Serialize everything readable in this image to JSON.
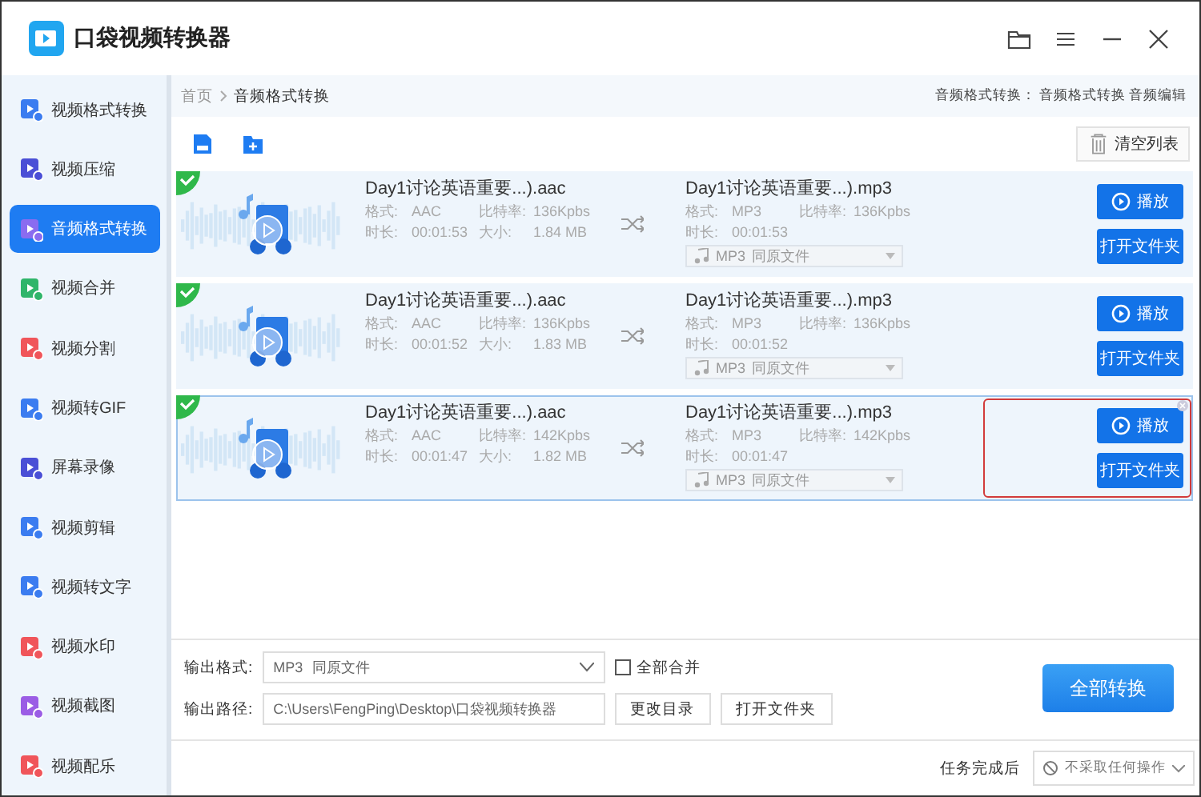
{
  "app": {
    "title": "口袋视频转换器"
  },
  "sidebar": {
    "items": [
      {
        "label": "视频格式转换",
        "selected": false,
        "color": "#3b7cf0"
      },
      {
        "label": "视频压缩",
        "selected": false,
        "color": "#4a4fd6"
      },
      {
        "label": "音频格式转换",
        "selected": true,
        "color": "#8a6cf0"
      },
      {
        "label": "视频合并",
        "selected": false,
        "color": "#2fb56a"
      },
      {
        "label": "视频分割",
        "selected": false,
        "color": "#f0555a"
      },
      {
        "label": "视频转GIF",
        "selected": false,
        "color": "#3b7cf0"
      },
      {
        "label": "屏幕录像",
        "selected": false,
        "color": "#4a4fd6"
      },
      {
        "label": "视频剪辑",
        "selected": false,
        "color": "#3b7cf0"
      },
      {
        "label": "视频转文字",
        "selected": false,
        "color": "#3b7cf0"
      },
      {
        "label": "视频水印",
        "selected": false,
        "color": "#f0555a"
      },
      {
        "label": "视频截图",
        "selected": false,
        "color": "#9b5de5"
      },
      {
        "label": "视频配乐",
        "selected": false,
        "color": "#f0555a"
      }
    ]
  },
  "breadcrumb": {
    "items": [
      "首页",
      "音频格式转换"
    ],
    "hint_label": "音频格式转换：",
    "hint_links": [
      "音频格式转换",
      "音频编辑"
    ]
  },
  "toolbar": {
    "clear_button": "清空列表"
  },
  "files": [
    {
      "done": true,
      "selected": false,
      "annotated": false,
      "source": {
        "name": "Day1讨论英语重要...).aac",
        "format_label": "格式:",
        "format": "AAC",
        "bitrate_label": "比特率:",
        "bitrate": "136Kpbs",
        "duration_label": "时长:",
        "duration": "00:01:53",
        "size_label": "大小:",
        "size": "1.84 MB"
      },
      "output": {
        "name": "Day1讨论英语重要...).mp3",
        "format_label": "格式:",
        "format": "MP3",
        "bitrate_label": "比特率:",
        "bitrate": "136Kpbs",
        "duration_label": "时长:",
        "duration": "00:01:53",
        "preset_format": "MP3",
        "preset_quality": "同原文件"
      },
      "play_button": "播放",
      "open_button": "打开文件夹"
    },
    {
      "done": true,
      "selected": false,
      "annotated": false,
      "source": {
        "name": "Day1讨论英语重要...).aac",
        "format_label": "格式:",
        "format": "AAC",
        "bitrate_label": "比特率:",
        "bitrate": "136Kpbs",
        "duration_label": "时长:",
        "duration": "00:01:52",
        "size_label": "大小:",
        "size": "1.83 MB"
      },
      "output": {
        "name": "Day1讨论英语重要...).mp3",
        "format_label": "格式:",
        "format": "MP3",
        "bitrate_label": "比特率:",
        "bitrate": "136Kpbs",
        "duration_label": "时长:",
        "duration": "00:01:52",
        "preset_format": "MP3",
        "preset_quality": "同原文件"
      },
      "play_button": "播放",
      "open_button": "打开文件夹"
    },
    {
      "done": true,
      "selected": true,
      "annotated": true,
      "source": {
        "name": "Day1讨论英语重要...).aac",
        "format_label": "格式:",
        "format": "AAC",
        "bitrate_label": "比特率:",
        "bitrate": "142Kpbs",
        "duration_label": "时长:",
        "duration": "00:01:47",
        "size_label": "大小:",
        "size": "1.82 MB"
      },
      "output": {
        "name": "Day1讨论英语重要...).mp3",
        "format_label": "格式:",
        "format": "MP3",
        "bitrate_label": "比特率:",
        "bitrate": "142Kpbs",
        "duration_label": "时长:",
        "duration": "00:01:47",
        "preset_format": "MP3",
        "preset_quality": "同原文件"
      },
      "play_button": "播放",
      "open_button": "打开文件夹"
    }
  ],
  "settings": {
    "format_label": "输出格式:",
    "format": "MP3",
    "quality": "同原文件",
    "merge": {
      "label": "全部合并",
      "checked": false
    },
    "path_label": "输出路径:",
    "path": "C:\\Users\\FengPing\\Desktop\\口袋视频转换器",
    "change_button": "更改目录",
    "open_button": "打开文件夹",
    "convert_button": "全部转换"
  },
  "status_bar": {
    "label": "任务完成后",
    "action": "不采取任何操作"
  }
}
